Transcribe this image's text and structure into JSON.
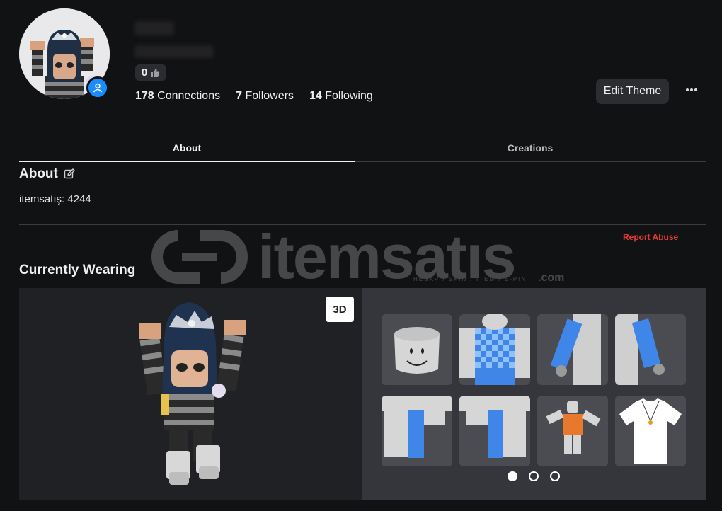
{
  "profile": {
    "likes": "0",
    "connections_count": "178",
    "connections_label": "Connections",
    "followers_count": "7",
    "followers_label": "Followers",
    "following_count": "14",
    "following_label": "Following",
    "edit_theme": "Edit Theme",
    "more_icon": "more-horizontal-icon"
  },
  "tabs": [
    "About",
    "Creations"
  ],
  "about": {
    "title": "About",
    "text": "itemsatış: 4244",
    "report": "Report Abuse"
  },
  "watermark": {
    "text": "itemsatıs",
    "sub": "HESAP / SKIN / ITEM / E-PIN",
    "com": ".com"
  },
  "wearing": {
    "title": "Currently Wearing",
    "view_3d": "3D",
    "items": [
      "head",
      "checkered-shirt",
      "left-arm",
      "right-arm",
      "left-leg",
      "right-leg",
      "character-bundle",
      "necklace-tshirt"
    ],
    "pagination": {
      "pages": 3,
      "current": 1
    }
  },
  "colors": {
    "background": "#111214",
    "accent_blue": "#1a8cff",
    "report_red": "#e53935"
  }
}
